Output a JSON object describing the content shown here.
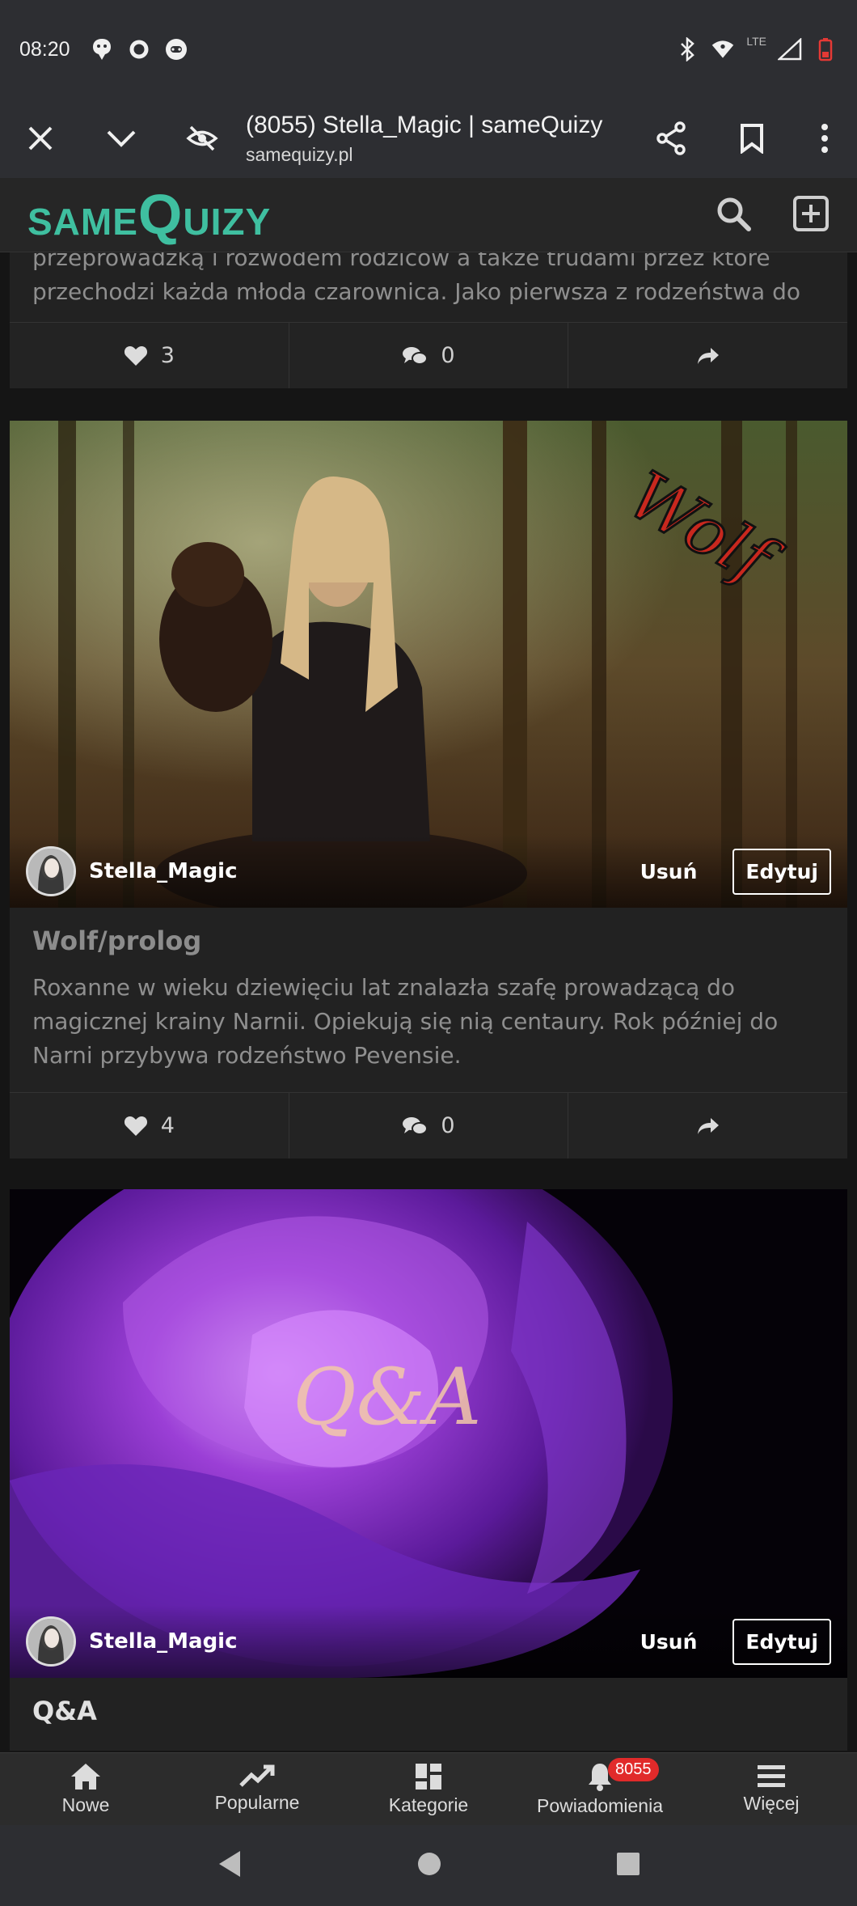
{
  "status_bar": {
    "time": "08:20",
    "network": "LTE"
  },
  "browser": {
    "tab_title": "(8055) Stella_Magic | sameQuizy",
    "url": "samequizy.pl"
  },
  "site": {
    "logo_prefix": "SAME",
    "logo_q": "Q",
    "logo_suffix": "UIZY",
    "brand_color": "#3fbfa0"
  },
  "cards": [
    {
      "text": "przeprowadzką i rozwodem rodziców a także trudami przez które przechodzi każda młoda czarownica. Jako pierwsza z rodzeństwa do",
      "likes": "3",
      "comments": "0"
    },
    {
      "image_overlay_text": "Wolf",
      "author": "Stella_Magic",
      "delete_label": "Usuń",
      "edit_label": "Edytuj",
      "title": "Wolf/prolog",
      "description": "Roxanne w wieku dziewięciu lat znalazła szafę prowadzącą do magicznej krainy Narnii. Opiekują się nią centaury. Rok później do Narni przybywa rodzeństwo Pevensie.",
      "likes": "4",
      "comments": "0"
    },
    {
      "image_overlay_text": "Q&A",
      "author": "Stella_Magic",
      "delete_label": "Usuń",
      "edit_label": "Edytuj",
      "title": "Q&A"
    }
  ],
  "bottom_nav": {
    "items": [
      {
        "label": "Nowe",
        "icon": "home-icon"
      },
      {
        "label": "Popularne",
        "icon": "trending-icon"
      },
      {
        "label": "Kategorie",
        "icon": "dashboard-icon"
      },
      {
        "label": "Powiadomienia",
        "icon": "bell-icon"
      },
      {
        "label": "Więcej",
        "icon": "menu-icon"
      }
    ],
    "notification_count": "8055"
  }
}
